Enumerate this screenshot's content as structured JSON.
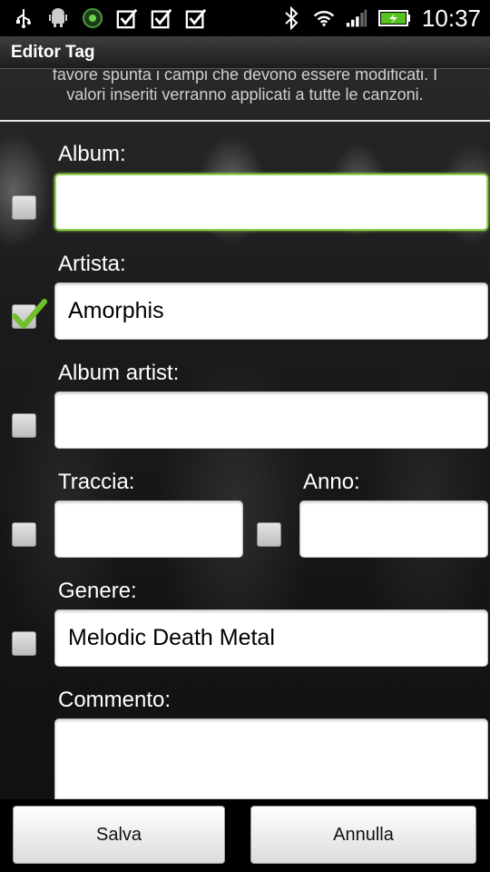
{
  "status_bar": {
    "time": "10:37",
    "left_icons": [
      "usb-icon",
      "android-debug-icon",
      "sync-icon",
      "check-box-icon",
      "check-box-icon",
      "check-box-icon"
    ],
    "right_icons": [
      "bluetooth-icon",
      "wifi-icon",
      "signal-icon",
      "battery-charging-icon"
    ]
  },
  "title_bar": {
    "title": "Editor Tag"
  },
  "instructions": {
    "line1": "favore spunta i campi che devono essere modificati. I",
    "line2": "valori inseriti verranno applicati a tutte le canzoni."
  },
  "fields": {
    "album": {
      "label": "Album:",
      "value": "",
      "checked": false
    },
    "artista": {
      "label": "Artista:",
      "value": "Amorphis",
      "checked": true
    },
    "album_artist": {
      "label": "Album artist:",
      "value": "",
      "checked": false
    },
    "traccia": {
      "label": "Traccia:",
      "value": "",
      "checked": false
    },
    "anno": {
      "label": "Anno:",
      "value": "",
      "checked": false
    },
    "genere": {
      "label": "Genere:",
      "value": "Melodic Death Metal",
      "checked": false
    },
    "commento": {
      "label": "Commento:",
      "value": "",
      "checked": false
    }
  },
  "buttons": {
    "save": "Salva",
    "cancel": "Annulla"
  },
  "colors": {
    "focus_accent": "#8fd14a",
    "checkmark": "#6fbf2a"
  }
}
